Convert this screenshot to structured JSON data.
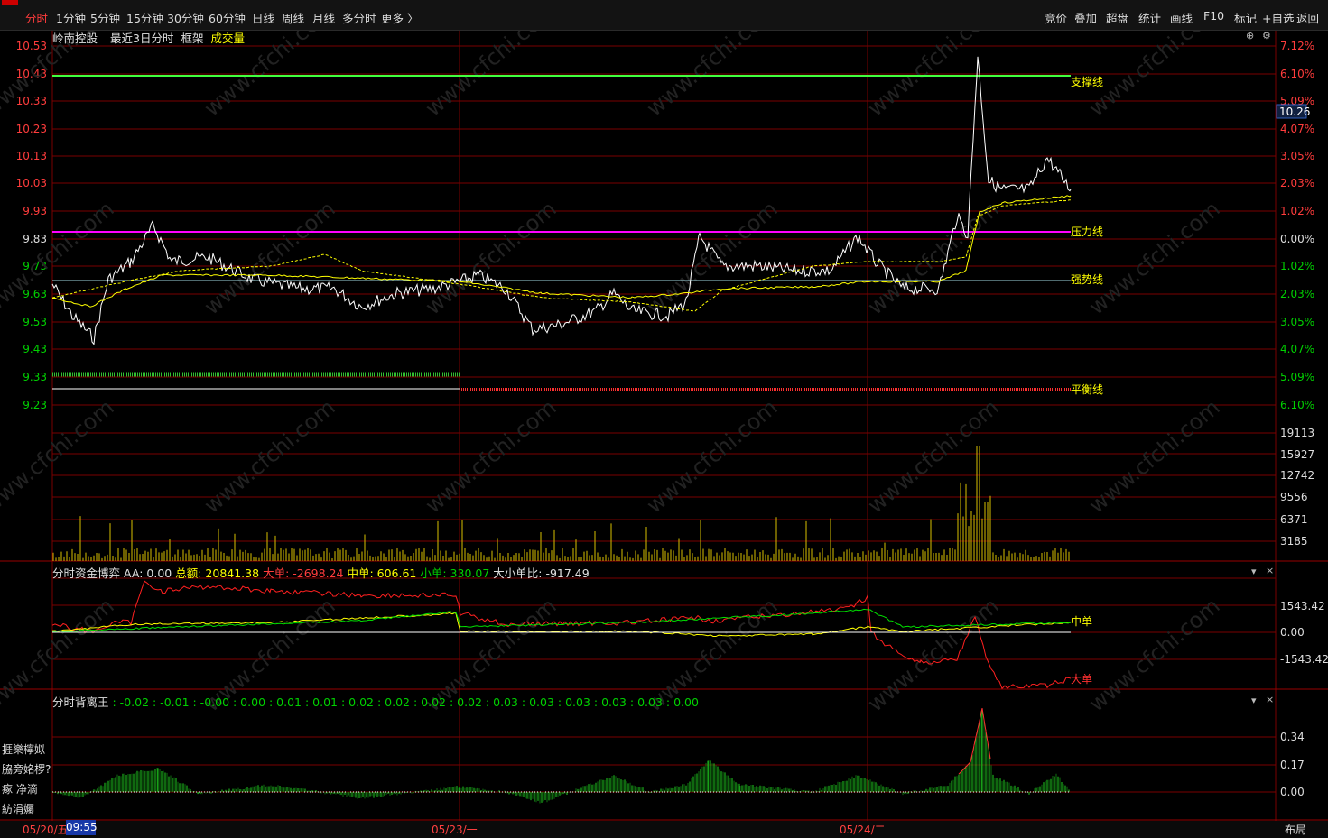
{
  "period_tabs": [
    "分时",
    "1分钟",
    "5分钟",
    "15分钟",
    "30分钟",
    "60分钟",
    "日线",
    "周线",
    "月线",
    "多分时",
    "更多 〉"
  ],
  "active_tab": "分时",
  "toolbar": [
    "竞价",
    "叠加",
    "超盘",
    "统计",
    "画线",
    "F10",
    "标记",
    "+自选",
    "返回"
  ],
  "stock_name": "岭南控股",
  "view_mode": "最近3日分时",
  "frame_label": "框架",
  "volume_label": "成交量",
  "price_axis": [
    "10.53",
    "10.43",
    "10.33",
    "10.23",
    "10.13",
    "10.03",
    "9.93",
    "9.83",
    "9.73",
    "9.63",
    "9.53",
    "9.43",
    "9.33",
    "9.23"
  ],
  "pct_axis": [
    "7.12%",
    "6.10%",
    "5.09%",
    "4.07%",
    "3.05%",
    "2.03%",
    "1.02%",
    "0.00%",
    "1.02%",
    "2.03%",
    "3.05%",
    "4.07%",
    "5.09%",
    "6.10%"
  ],
  "current_price": "10.26",
  "line_labels": {
    "support": "支撑线",
    "pressure": "压力线",
    "strong": "强势线",
    "balance": "平衡线"
  },
  "volume_axis": [
    "19113",
    "15927",
    "12742",
    "9556",
    "6371",
    "3185"
  ],
  "fund": {
    "title": "分时资金博弈",
    "aa": "AA: 0.00",
    "total": "总额: 20841.38",
    "big": "大单: -2698.24",
    "mid": "中单: 606.61",
    "small": "小单: 330.07",
    "ratio": "大小单比: -917.49",
    "axis": [
      "1543.42",
      "0.00",
      "-1543.42"
    ],
    "label_mid": "中单",
    "label_big": "大单"
  },
  "divergence": {
    "title": "分时背离王",
    "values": ": -0.02 : -0.01 : -0.00 : 0.00 : 0.01 : 0.01 : 0.02 : 0.02 : 0.02 : 0.02 : 0.03 : 0.03 : 0.03 : 0.03 : 0.03 : 0.00",
    "axis": [
      "0.34",
      "0.17",
      "0.00"
    ]
  },
  "side_labels": [
    "捱樂檸姒",
    "脇旁姳椤?",
    "瘃  净滴",
    "紡涓孎"
  ],
  "dates": [
    "05/20/五",
    "05/23/一",
    "05/24/二"
  ],
  "time_cursor": "09:55",
  "layout_btn": "布局",
  "panel_controls": {
    "collapse": "▾",
    "close": "×",
    "plus": "⊕",
    "settings": "⚙"
  },
  "watermark": "www.cfchi.com",
  "colors": {
    "up": "#ff3c3c",
    "down": "#00d000",
    "price": "#ffffff",
    "avg": "#ffff00",
    "grid": "#7a0000",
    "support": "#40ff40",
    "pressure": "#ff00ff",
    "strong": "#a0d8e0"
  }
}
